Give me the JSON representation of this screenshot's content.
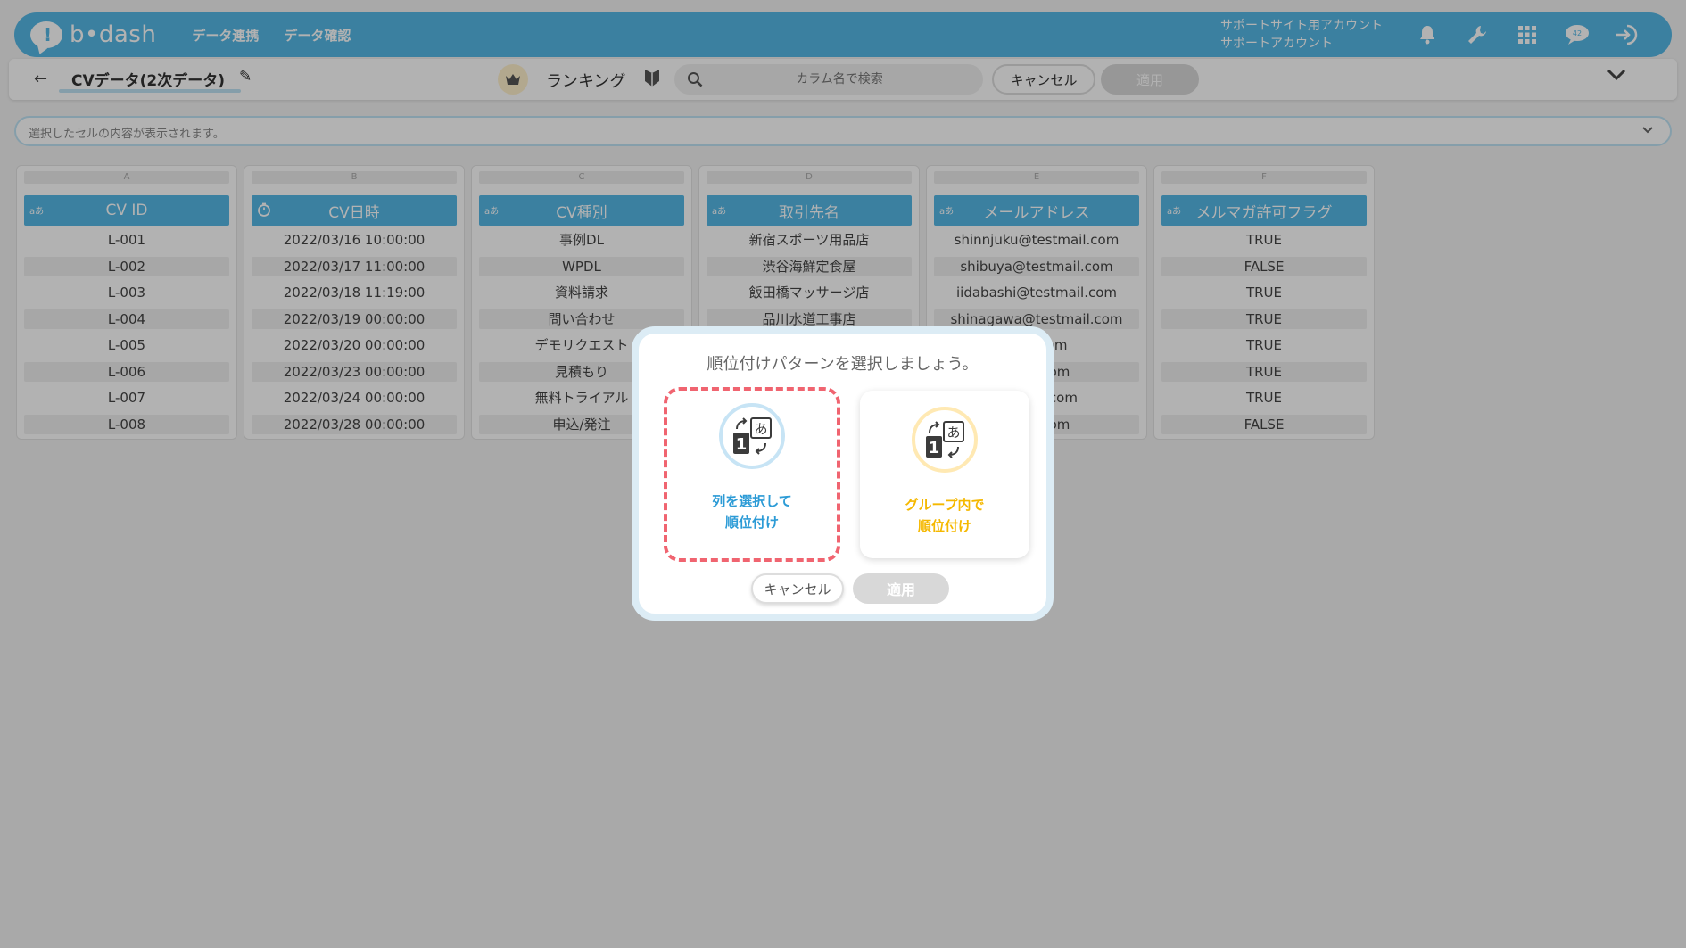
{
  "header": {
    "logo_text": "b•dash",
    "nav": [
      "データ連携",
      "データ確認"
    ],
    "account_line1": "サポートサイト用アカウント",
    "account_line2": "サポートアカウント",
    "color": "#55b8e6"
  },
  "toolbar": {
    "table_name": "CVデータ(2次データ)",
    "mode_label": "ランキング",
    "search_placeholder": "カラム名で検索",
    "cancel_label": "キャンセル",
    "apply_label": "適用"
  },
  "cellbar": {
    "placeholder": "選択したセルの内容が表示されます。"
  },
  "columns": [
    {
      "letter": "A",
      "type": "aあ",
      "name": "CV ID",
      "cells": [
        "L-001",
        "L-002",
        "L-003",
        "L-004",
        "L-005",
        "L-006",
        "L-007",
        "L-008"
      ]
    },
    {
      "letter": "B",
      "type": "timer",
      "name": "CV日時",
      "cells": [
        "2022/03/16 10:00:00",
        "2022/03/17 11:00:00",
        "2022/03/18 11:19:00",
        "2022/03/19 00:00:00",
        "2022/03/20 00:00:00",
        "2022/03/23 00:00:00",
        "2022/03/24 00:00:00",
        "2022/03/28 00:00:00"
      ]
    },
    {
      "letter": "C",
      "type": "aあ",
      "name": "CV種別",
      "cells": [
        "事例DL",
        "WPDL",
        "資料請求",
        "問い合わせ",
        "デモリクエスト",
        "見積もり",
        "無料トライアル",
        "申込/発注"
      ]
    },
    {
      "letter": "D",
      "type": "aあ",
      "name": "取引先名",
      "cells": [
        "新宿スポーツ用品店",
        "渋谷海鮮定食屋",
        "飯田橋マッサージ店",
        "品川水道工事店",
        "",
        "",
        "",
        ""
      ]
    },
    {
      "letter": "E",
      "type": "aあ",
      "name": "メールアドレス",
      "cells": [
        "shinnjuku@testmail.com",
        "shibuya@testmail.com",
        "iidabashi@testmail.com",
        "shinagawa@testmail.com",
        "mail.com",
        "tmail.com",
        "estmail.com",
        "tmail.com"
      ]
    },
    {
      "letter": "F",
      "type": "aあ",
      "name": "メルマガ許可フラグ",
      "cells": [
        "TRUE",
        "FALSE",
        "TRUE",
        "TRUE",
        "TRUE",
        "TRUE",
        "TRUE",
        "FALSE"
      ]
    }
  ],
  "modal": {
    "title": "順位付けパターンを選択しましょう。",
    "option_left_line1": "列を選択して",
    "option_left_line2": "順位付け",
    "option_right_line1": "グループ内で",
    "option_right_line2": "順位付け",
    "cancel_label": "キャンセル",
    "apply_label": "適用",
    "left_color": "#2c9bd6",
    "right_color": "#f5b800",
    "highlight_color": "#f06470"
  }
}
